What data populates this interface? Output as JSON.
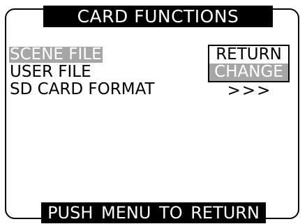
{
  "screen": {
    "title": "CARD FUNCTIONS",
    "footer": "PUSH MENU TO RETURN"
  },
  "menu": {
    "items": [
      {
        "label": "SCENE FILE",
        "selected": true
      },
      {
        "label": "USER FILE",
        "selected": false
      },
      {
        "label": "SD CARD FORMAT",
        "selected": false
      }
    ]
  },
  "options": {
    "return_label": "RETURN",
    "change_label": "CHANGE",
    "arrows_label": ">>>",
    "selected": "CHANGE"
  },
  "colors": {
    "highlight": "#a6a6a6",
    "bar_background": "#000000",
    "bar_text": "#ffffff",
    "text": "#000000",
    "background": "#ffffff"
  }
}
